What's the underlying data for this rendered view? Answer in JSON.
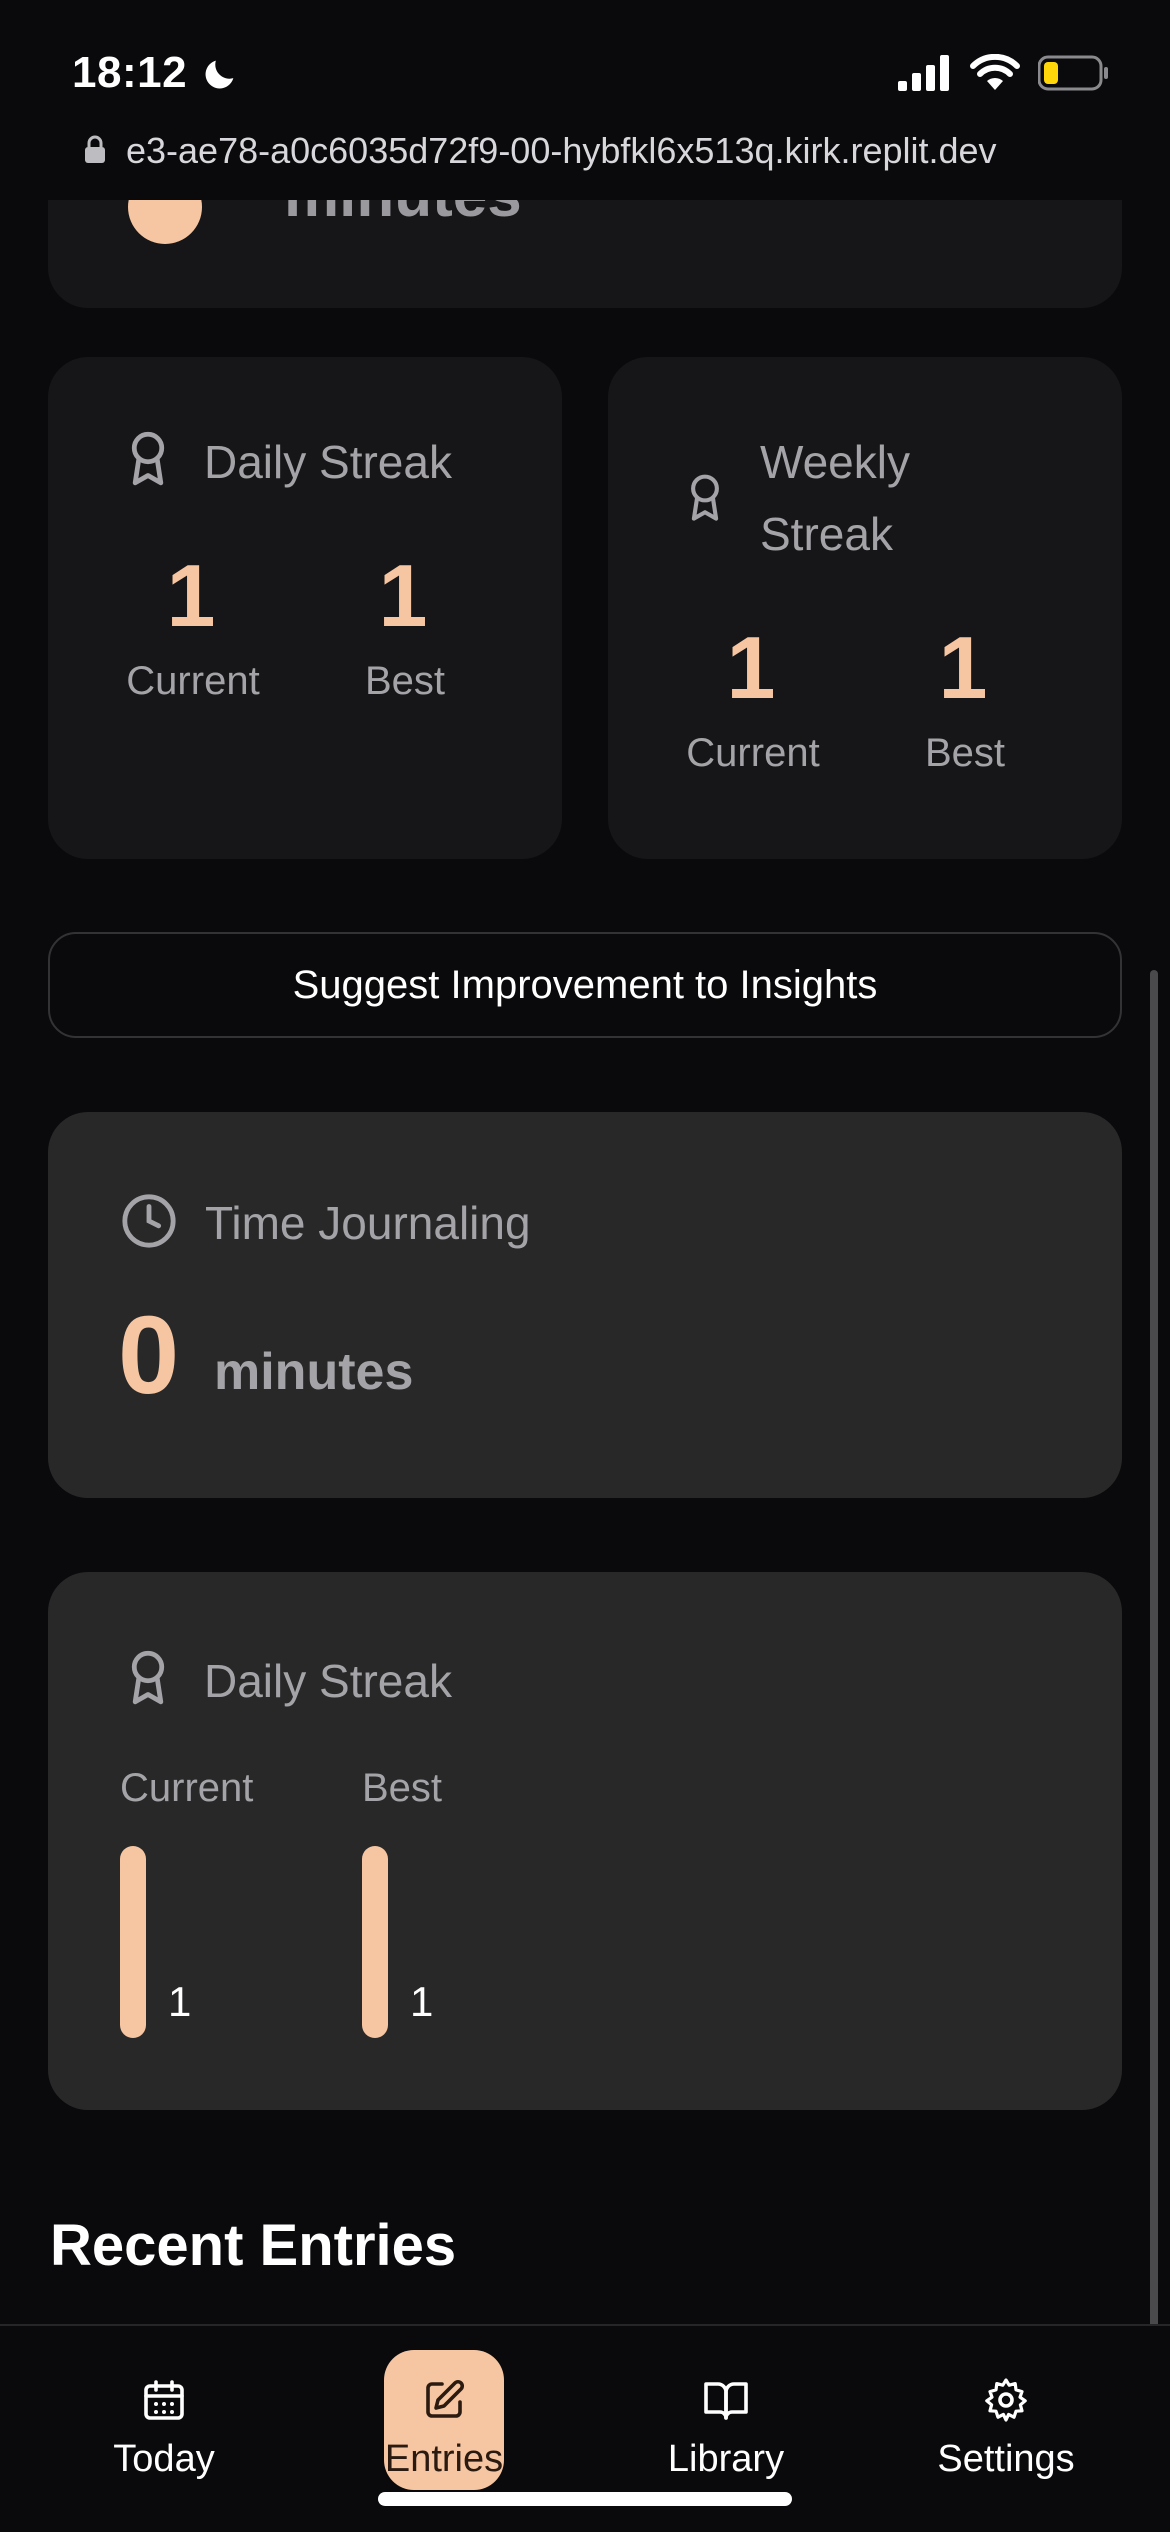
{
  "status_bar": {
    "time": "18:12"
  },
  "browser": {
    "url": "e3-ae78-a0c6035d72f9-00-hybfkl6x513q.kirk.replit.dev"
  },
  "top_card": {
    "partial_label": "minutes"
  },
  "daily_streak": {
    "title": "Daily Streak",
    "current_value": "1",
    "current_label": "Current",
    "best_value": "1",
    "best_label": "Best"
  },
  "weekly_streak": {
    "title_line1": "Weekly",
    "title_line2": "Streak",
    "current_value": "1",
    "current_label": "Current",
    "best_value": "1",
    "best_label": "Best"
  },
  "suggest_button": {
    "label": "Suggest Improvement to Insights"
  },
  "time_journaling": {
    "title": "Time Journaling",
    "value": "0",
    "unit": "minutes"
  },
  "daily_streak_chart": {
    "title": "Daily Streak",
    "current_label": "Current",
    "best_label": "Best",
    "current_value": "1",
    "best_value": "1"
  },
  "recent_entries": {
    "title": "Recent Entries"
  },
  "nav": {
    "items": [
      {
        "label": "Today",
        "icon": "calendar-icon"
      },
      {
        "label": "Entries",
        "icon": "edit-icon",
        "active": true
      },
      {
        "label": "Library",
        "icon": "book-open-icon"
      },
      {
        "label": "Settings",
        "icon": "gear-icon"
      }
    ]
  },
  "colors": {
    "accent": "#f6c5a1",
    "background": "#0a0a0c",
    "card": "#161618",
    "card_alt": "#282829",
    "muted": "#a4a4a8"
  }
}
